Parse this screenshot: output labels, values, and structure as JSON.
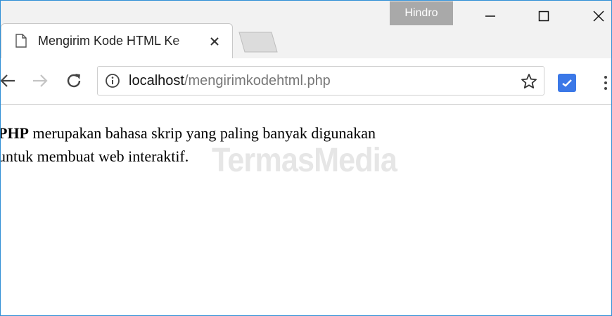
{
  "browser": {
    "profile_name": "Hindro",
    "tab": {
      "title": "Mengirim Kode HTML Ke"
    },
    "address_bar": {
      "host": "localhost",
      "path": "/mengirimkodehtml.php"
    },
    "icons": {
      "page": "page-icon",
      "close_tab": "close-icon",
      "back": "back-arrow-icon",
      "forward": "forward-arrow-icon",
      "reload": "reload-icon",
      "info": "info-icon",
      "star": "star-icon",
      "extension": "extension-check-icon",
      "menu": "kebab-menu-icon"
    },
    "colors": {
      "accent": "#3b78e7",
      "window_border": "#2f8fd6",
      "profile_badge": "#a9a9a9"
    }
  },
  "page": {
    "bold_word": "PHP",
    "text_line_1": " merupakan bahasa skrip yang paling banyak digunakan",
    "text_line_2": "untuk membuat web interaktif."
  },
  "watermark": "TermasMedia"
}
